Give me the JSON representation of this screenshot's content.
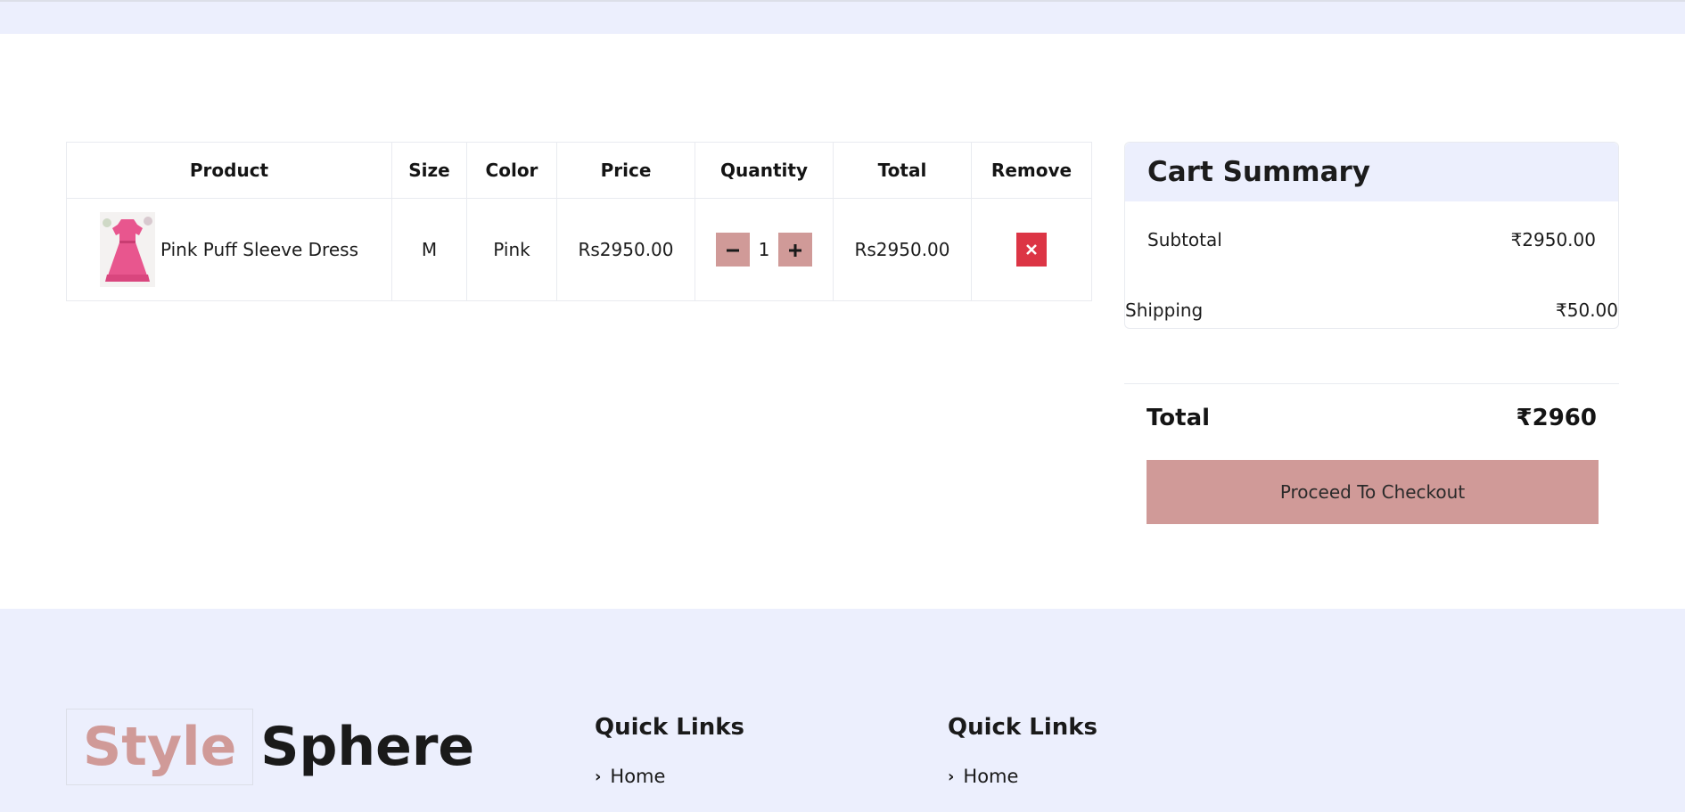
{
  "cart": {
    "headers": {
      "product": "Product",
      "size": "Size",
      "color": "Color",
      "price": "Price",
      "quantity": "Quantity",
      "total": "Total",
      "remove": "Remove"
    },
    "items": [
      {
        "name": "Pink Puff Sleeve Dress",
        "size": "M",
        "color": "Pink",
        "price": "Rs2950.00",
        "quantity": "1",
        "total": "Rs2950.00",
        "image": "pink-dress-image"
      }
    ],
    "minus_icon": "minus-icon",
    "plus_icon": "plus-icon",
    "remove_icon": "close-icon"
  },
  "summary": {
    "title": "Cart Summary",
    "subtotal_label": "Subtotal",
    "subtotal_value": "₹2950.00",
    "shipping_label": "Shipping",
    "shipping_value": "₹50.00",
    "total_label": "Total",
    "total_value": "₹2960",
    "checkout_label": "Proceed To Checkout"
  },
  "footer": {
    "logo_part1": "Style",
    "logo_part2": "Sphere",
    "columns": [
      {
        "title": "Quick Links",
        "items": [
          "Home"
        ]
      },
      {
        "title": "Quick Links",
        "items": [
          "Home"
        ]
      }
    ]
  },
  "colors": {
    "accent": "#d09a98",
    "danger": "#dc3545",
    "panel": "#eceffd"
  }
}
